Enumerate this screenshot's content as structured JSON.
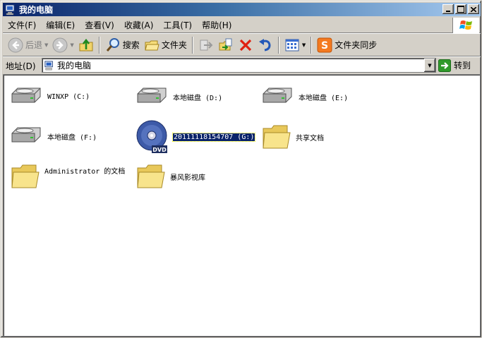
{
  "window": {
    "title": "我的电脑"
  },
  "menu": {
    "items": [
      "文件(F)",
      "编辑(E)",
      "查看(V)",
      "收藏(A)",
      "工具(T)",
      "帮助(H)"
    ]
  },
  "toolbar": {
    "back_label": "后退",
    "search_label": "搜索",
    "folders_label": "文件夹",
    "sync_label": "文件夹同步"
  },
  "address": {
    "label": "地址(D)",
    "value": "我的电脑",
    "go_label": "转到"
  },
  "items": [
    {
      "name": "WINXP (C:)",
      "icon": "hard-drive-icon"
    },
    {
      "name": "本地磁盘 (D:)",
      "icon": "hard-drive-icon"
    },
    {
      "name": "本地磁盘 (E:)",
      "icon": "hard-drive-icon"
    },
    {
      "name": "本地磁盘 (F:)",
      "icon": "hard-drive-icon"
    },
    {
      "name": "20111118154707 (G:)",
      "icon": "dvd-drive-icon",
      "selected": true
    },
    {
      "name": "共享文档",
      "icon": "folder-icon"
    },
    {
      "name": "Administrator 的文档",
      "icon": "folder-icon"
    },
    {
      "name": "暴风影视库",
      "icon": "folder-icon"
    }
  ],
  "colors": {
    "title_start": "#0a246a",
    "title_end": "#a6caf0",
    "selection": "#0a246a"
  }
}
